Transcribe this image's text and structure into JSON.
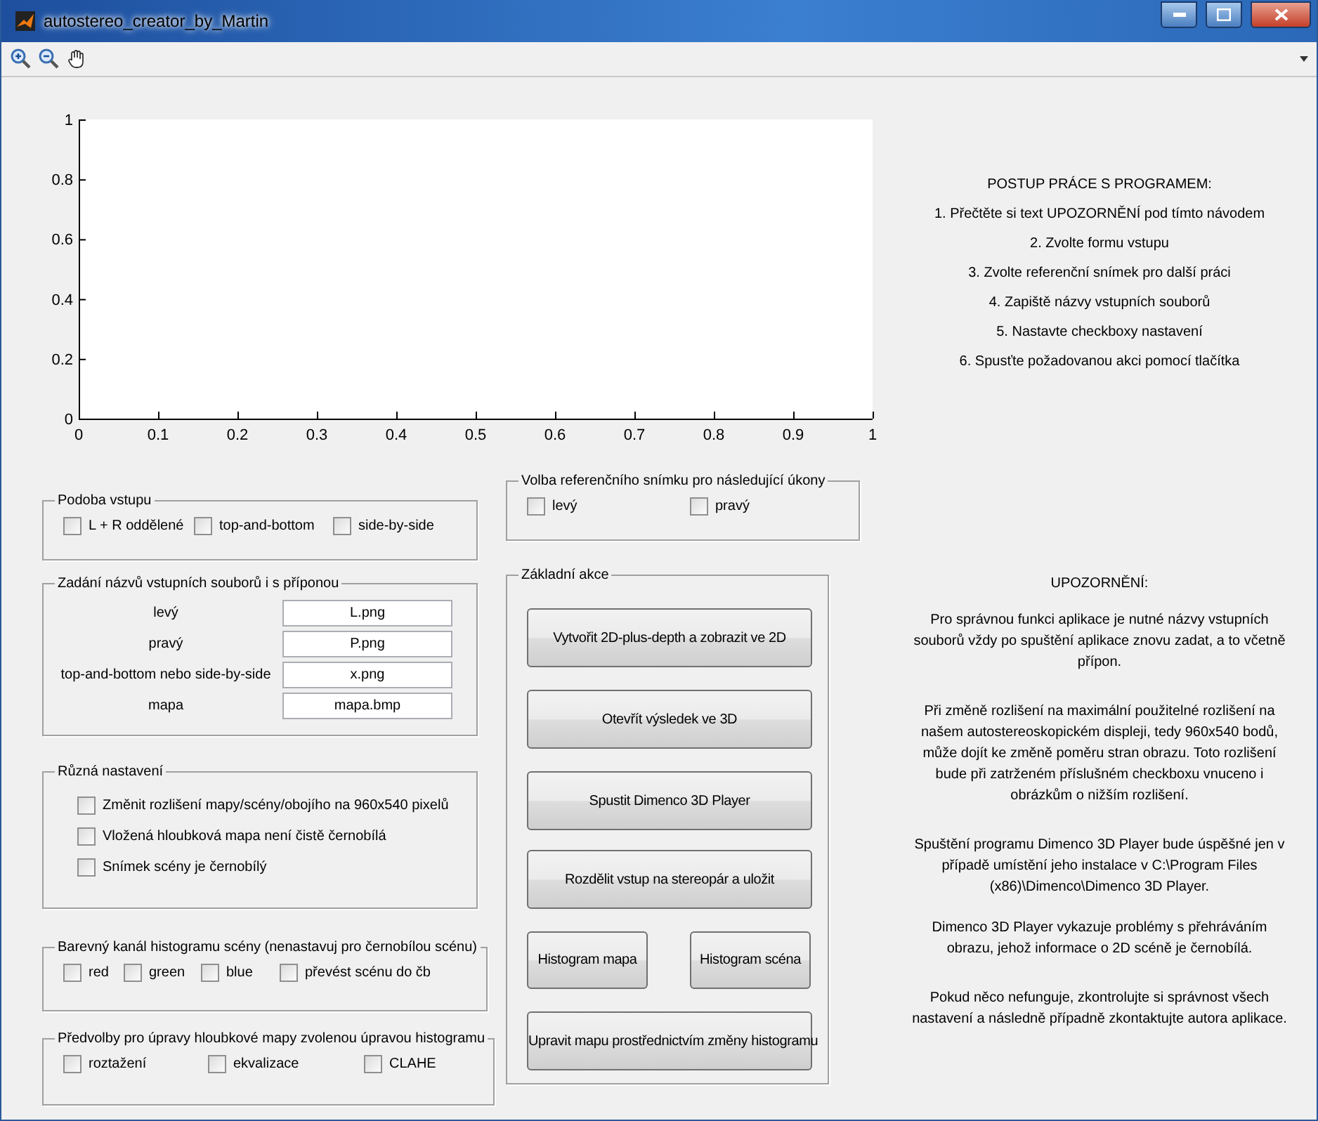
{
  "window": {
    "title": "autostereo_creator_by_Martin"
  },
  "axes": {
    "chart_data": {
      "type": "line",
      "xlim": [
        0,
        1
      ],
      "ylim": [
        0,
        1
      ],
      "xticks": [
        0,
        0.1,
        0.2,
        0.3,
        0.4,
        0.5,
        0.6,
        0.7,
        0.8,
        0.9,
        1
      ],
      "yticks": [
        0,
        0.2,
        0.4,
        0.6,
        0.8,
        1
      ]
    }
  },
  "left_panels": [
    {
      "kind": "checkrow",
      "title": "Podoba vstupu",
      "items": [
        {
          "label": "L + R oddělené",
          "checked": false
        },
        {
          "label": "top-and-bottom",
          "checked": false
        },
        {
          "label": "side-by-side",
          "checked": false
        }
      ]
    },
    {
      "kind": "fields",
      "title": "Zadání názvů vstupních souborů i s příponou",
      "fields": [
        {
          "label": "levý",
          "value": "L.png"
        },
        {
          "label": "pravý",
          "value": "P.png"
        },
        {
          "label": "top-and-bottom nebo side-by-side",
          "value": "x.png"
        },
        {
          "label": "mapa",
          "value": "mapa.bmp"
        }
      ]
    },
    {
      "kind": "checklist",
      "title": "Různá nastavení",
      "items": [
        {
          "label": "Změnit rozlišení mapy/scény/obojího na 960x540 pixelů",
          "checked": false
        },
        {
          "label": "Vložená hloubková mapa není čistě černobílá",
          "checked": false
        },
        {
          "label": "Snímek scény je černobílý",
          "checked": false
        }
      ]
    },
    {
      "kind": "checkrow",
      "title": "Barevný kanál histogramu scény (nenastavuj pro černobílou scénu)",
      "items": [
        {
          "label": "red",
          "checked": false
        },
        {
          "label": "green",
          "checked": false
        },
        {
          "label": "blue",
          "checked": false
        },
        {
          "label": "převést scénu do čb",
          "checked": false
        }
      ]
    },
    {
      "kind": "checkrow",
      "title": "Předvolby pro úpravy hloubkové mapy zvolenou úpravou histogramu",
      "items": [
        {
          "label": "roztažení",
          "checked": false
        },
        {
          "label": "ekvalizace",
          "checked": false
        },
        {
          "label": "CLAHE",
          "checked": false
        }
      ]
    }
  ],
  "reference_panel": {
    "title": "Volba referenčního snímku pro následující úkony",
    "items": [
      {
        "label": "levý",
        "checked": false
      },
      {
        "label": "pravý",
        "checked": false
      }
    ]
  },
  "actions_panel": {
    "title": "Základní akce",
    "buttons": [
      {
        "kind": "wide",
        "label": "Vytvořit 2D-plus-depth a zobrazit ve 2D"
      },
      {
        "kind": "wide",
        "label": "Otevřít výsledek ve 3D"
      },
      {
        "kind": "wide",
        "label": "Spustit Dimenco 3D Player"
      },
      {
        "kind": "wide",
        "label": "Rozdělit vstup na stereopár a uložit"
      },
      {
        "kind": "half",
        "label": "Histogram mapa"
      },
      {
        "kind": "half",
        "label": "Histogram scéna"
      },
      {
        "kind": "wide",
        "label": "Upravit mapu prostřednictvím změny histogramu"
      }
    ]
  },
  "instructions": {
    "title": "POSTUP PRÁCE S PROGRAMEM:",
    "steps": [
      "1. Přečtěte si text UPOZORNĚNÍ pod tímto návodem",
      "2. Zvolte formu vstupu",
      "3. Zvolte referenční snímek pro další práci",
      "4. Zapiště názvy vstupních souborů",
      "5. Nastavte checkboxy nastavení",
      "6. Spusťte požadovanou akci pomocí tlačítka"
    ]
  },
  "warning": {
    "title": "UPOZORNĚNÍ:",
    "paragraphs": [
      "Pro správnou funkci aplikace je nutné názvy vstupních souborů vždy po spuštění aplikace znovu zadat, a to včetně přípon.",
      "Při změně rozlišení na maximální použitelné rozlišení na našem autostereoskopickém displeji, tedy 960x540 bodů, může dojít ke změně poměru stran obrazu. Toto rozlišení bude při zatrženém příslušném checkboxu vnuceno i obrázkům o nižším rozlišení.",
      "Spuštění programu Dimenco 3D Player bude úspěšné jen v případě umístění jeho instalace v  C:\\Program Files (x86)\\Dimenco\\Dimenco 3D Player.",
      "Dimenco 3D Player vykazuje problémy s přehráváním obrazu, jehož informace o 2D scéně je černobílá.",
      "Pokud něco nefunguje, zkontrolujte si správnost všech nastavení a následně případně zkontaktujte autora aplikace."
    ]
  }
}
